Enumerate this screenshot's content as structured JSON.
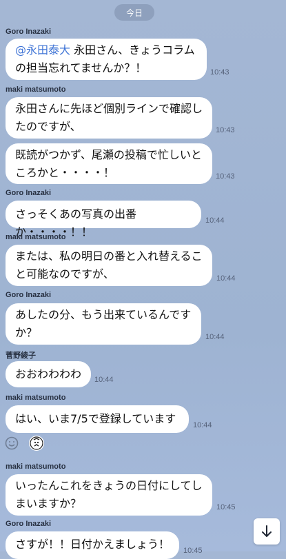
{
  "date_separator": "今日",
  "messages": [
    {
      "sender": "Goro Inazaki",
      "mention": "@永田泰大",
      "text": " 永田さん、きょうコラムの担当忘れてませんか？！",
      "time": "10:43"
    },
    {
      "sender": "maki matsumoto",
      "text": "永田さんに先ほど個別ラインで確認したのですが、",
      "time": "10:43"
    },
    {
      "text": "既読がつかず、尾瀬の投稿で忙しいところかと・・・・！",
      "time": "10:43"
    },
    {
      "sender": "Goro Inazaki",
      "text": "さっそくあの写真の出番か・・・・！！",
      "time": "10:44"
    },
    {
      "sender": "maki matsumoto",
      "text": "または、私の明日の番と入れ替えること可能なのですが、",
      "time": "10:44"
    },
    {
      "sender": "Goro Inazaki",
      "text": "あしたの分、もう出来ているんですか？",
      "time": "10:44"
    },
    {
      "sender": "菅野綾子",
      "text": "おおわわわわ",
      "time": "10:44"
    },
    {
      "sender": "maki matsumoto",
      "text": "はい、いま7/5で登録しています",
      "time": "10:44"
    },
    {
      "sender": "maki matsumoto",
      "text": "いったんこれをきょうの日付にしてしまいますか？",
      "time": "10:45"
    },
    {
      "sender": "Goro Inazaki",
      "text": "さすが！！日付かえましょう！",
      "time": "10:45"
    }
  ],
  "icons": {
    "reaction": "smiley-face-icon",
    "sticker": "character-sticker-icon",
    "scroll": "arrow-down-icon"
  }
}
